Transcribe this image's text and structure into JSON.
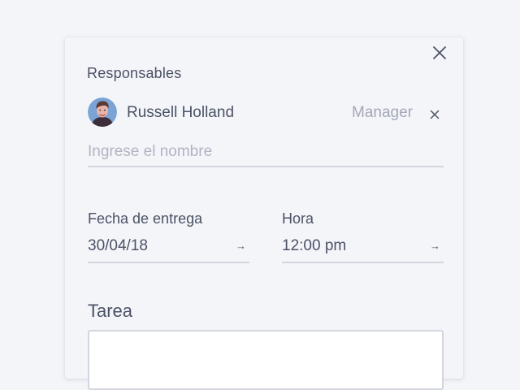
{
  "dialog": {
    "close_icon": "close-icon",
    "responsables": {
      "label": "Responsables",
      "assignee": {
        "name": "Russell Holland",
        "role": "Manager",
        "avatar": "avatar-photo",
        "remove_icon": "close-icon"
      },
      "input": {
        "placeholder": "Ingrese el nombre",
        "value": ""
      }
    },
    "fecha": {
      "label": "Fecha de entrega",
      "value": "30/04/18",
      "arrow": "→",
      "arrow_icon": "arrow-right-icon"
    },
    "hora": {
      "label": "Hora",
      "value": "12:00 pm",
      "arrow": "→",
      "arrow_icon": "arrow-right-icon"
    },
    "tarea": {
      "label": "Tarea",
      "value": ""
    }
  },
  "colors": {
    "background": "#f4f5f9",
    "text": "#4b5266",
    "muted_text": "#a3a8b7",
    "placeholder": "#b1b5c2",
    "divider": "#d3d6de",
    "avatar_bg": "#7aa3d6"
  }
}
